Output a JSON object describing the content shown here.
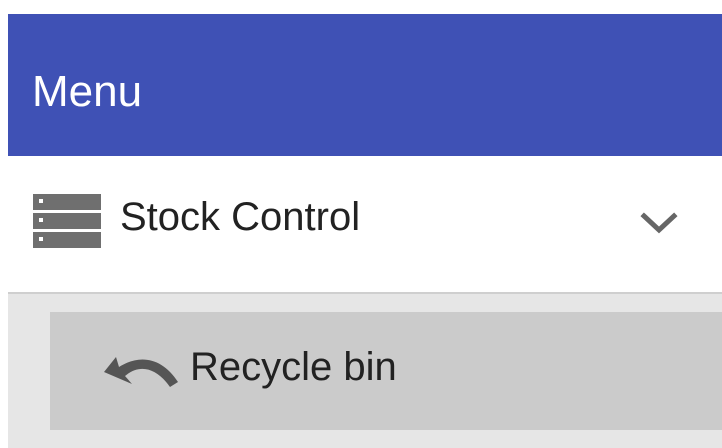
{
  "menu": {
    "title": "Menu",
    "color": "#3f51b5"
  },
  "section": {
    "label": "Stock Control",
    "icon": "server-icon",
    "toggle_icon": "chevron-down-icon"
  },
  "submenu": {
    "items": [
      {
        "label": "Recycle bin",
        "icon": "undo-arrow-icon"
      }
    ]
  }
}
